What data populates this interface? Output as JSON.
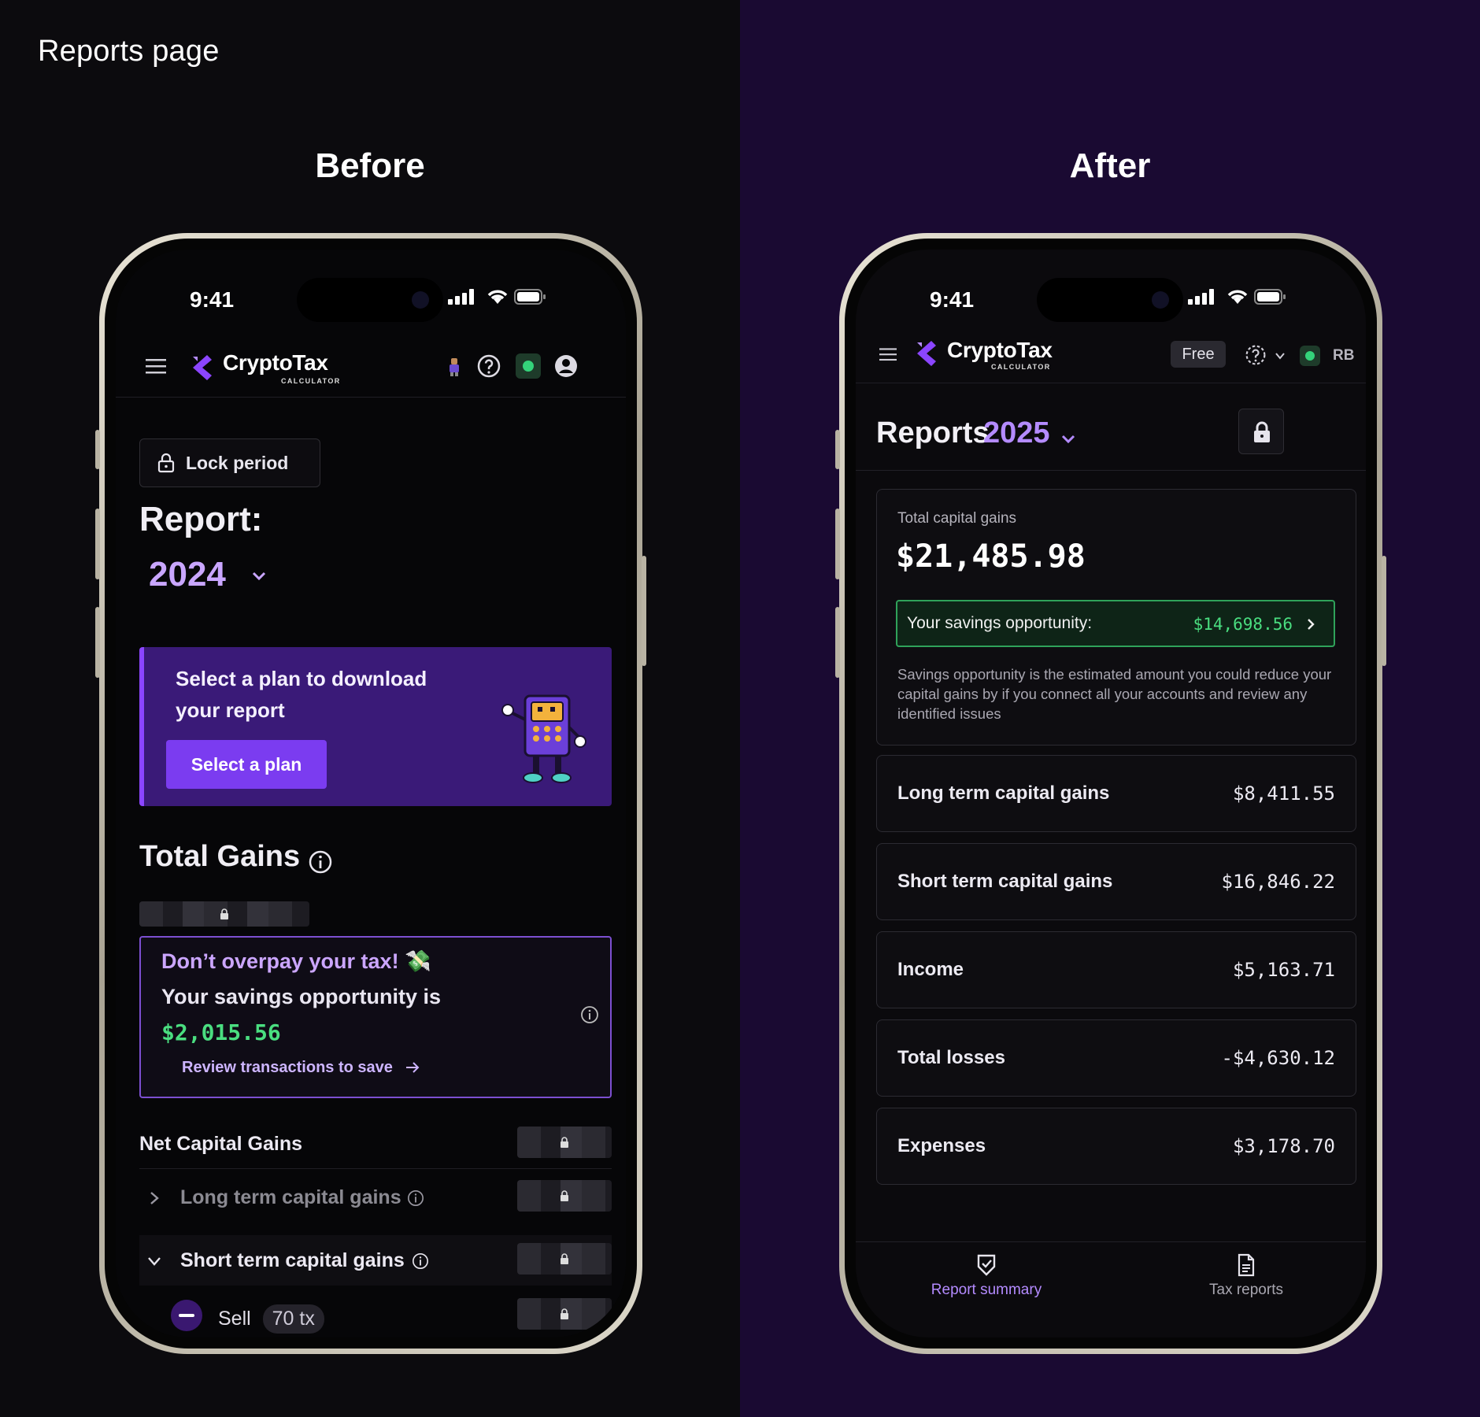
{
  "caption": "Reports page",
  "before": {
    "heading": "Before",
    "status_time": "9:41",
    "logo": {
      "main": "CryptoTax",
      "sub": "CALCULATOR"
    },
    "lock_period_label": "Lock period",
    "report_label": "Report:",
    "report_year": "2024",
    "plan_card": {
      "text": "Select a plan to download your report",
      "button": "Select a plan"
    },
    "total_gains_title": "Total Gains",
    "savings": {
      "line1": "Don’t overpay your tax! 💸",
      "line2": "Your savings opportunity is",
      "amount": "$2,015.56",
      "link": "Review transactions to save"
    },
    "rows": {
      "net": "Net Capital Gains",
      "long": "Long term capital gains",
      "short": "Short term capital gains",
      "sell": "Sell",
      "sell_count": "70 tx"
    },
    "colors": {
      "accent": "#7b3cf0",
      "year": "#c9a6ff",
      "success": "#4ade80"
    }
  },
  "after": {
    "heading": "After",
    "status_time": "9:41",
    "logo": {
      "main": "CryptoTax",
      "sub": "CALCULATOR"
    },
    "plan_badge": "Free",
    "user_initials": "RB",
    "title": "Reports",
    "year": "2025",
    "summary": {
      "caption": "Total capital gains",
      "total": "$21,485.98",
      "savings_label": "Your savings opportunity:",
      "savings_value": "$14,698.56",
      "note": "Savings opportunity is the estimated amount you could reduce your capital gains by if you connect all your accounts and review any identified issues"
    },
    "items": [
      {
        "label": "Long term capital gains",
        "value": "$8,411.55"
      },
      {
        "label": "Short term capital gains",
        "value": "$16,846.22"
      },
      {
        "label": "Income",
        "value": "$5,163.71"
      },
      {
        "label": "Total losses",
        "value": "-$4,630.12"
      },
      {
        "label": "Expenses",
        "value": "$3,178.70"
      }
    ],
    "tabs": [
      {
        "label": "Report summary",
        "icon": "shield-check-icon",
        "active": true
      },
      {
        "label": "Tax reports",
        "icon": "document-icon",
        "active": false
      }
    ],
    "colors": {
      "accent": "#b48bff",
      "success": "#4ade80",
      "background": "#1a0a32"
    }
  }
}
